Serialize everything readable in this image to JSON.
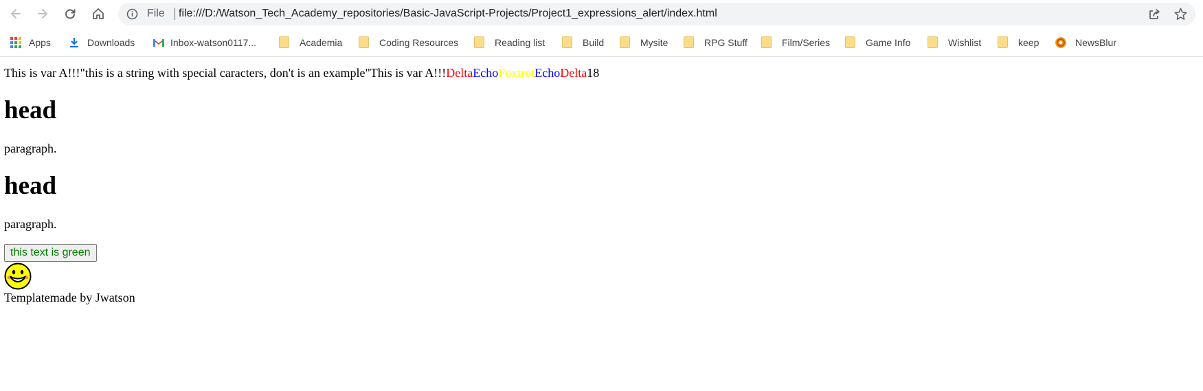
{
  "browser": {
    "url_scheme": "File",
    "url": "file:///D:/Watson_Tech_Academy_repositories/Basic-JavaScript-Projects/Project1_expressions_alert/index.html"
  },
  "bookmarks": [
    {
      "label": "Apps",
      "icon": "apps-grid-icon"
    },
    {
      "label": "Downloads",
      "icon": "download-icon"
    },
    {
      "label": "Inbox-watson0117...",
      "icon": "gmail-icon"
    },
    {
      "label": "Academia",
      "icon": "folder-icon"
    },
    {
      "label": "Coding Resources",
      "icon": "folder-icon"
    },
    {
      "label": "Reading list",
      "icon": "folder-icon"
    },
    {
      "label": "Build",
      "icon": "folder-icon"
    },
    {
      "label": "Mysite",
      "icon": "folder-icon"
    },
    {
      "label": "RPG Stuff",
      "icon": "folder-icon"
    },
    {
      "label": "Film/Series",
      "icon": "folder-icon"
    },
    {
      "label": "Game Info",
      "icon": "folder-icon"
    },
    {
      "label": "Wishlist",
      "icon": "folder-icon"
    },
    {
      "label": "keep",
      "icon": "folder-icon"
    },
    {
      "label": "NewsBlur",
      "icon": "newsblur-icon"
    }
  ],
  "content": {
    "line1_text": "This is var A!!!\"this is a string with special caracters, don't is an example\"This is var A!!!",
    "delta1": "Delta",
    "echo1": "Echo",
    "foxtrot": "Foxtrot",
    "echo2": "Echo",
    "delta2": "Delta",
    "number": "18",
    "heading1": "head",
    "paragraph1": "paragraph.",
    "heading2": "head",
    "paragraph2": "paragraph.",
    "button_label": "this text is green",
    "footer": "Templatemade by Jwatson"
  },
  "colors": {
    "red": "#ff0000",
    "blue": "#0000ff",
    "yellow": "#ffff00",
    "green": "#008000"
  }
}
